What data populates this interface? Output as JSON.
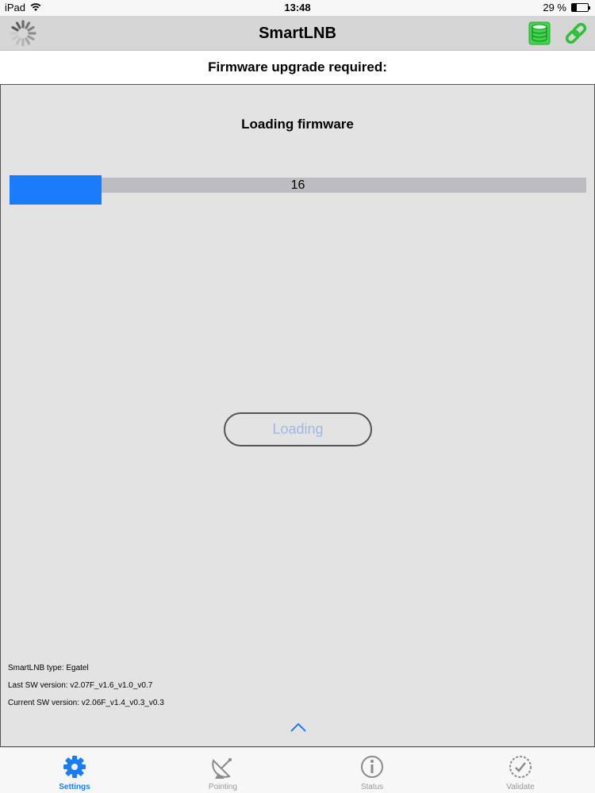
{
  "status_bar": {
    "device": "iPad",
    "time": "13:48",
    "battery": "29 %",
    "battery_level": 0.29
  },
  "nav": {
    "title": "SmartLNB"
  },
  "subheader": "Firmware upgrade required:",
  "panel": {
    "title": "Loading firmware",
    "progress": {
      "value": 16,
      "fraction": 0.16
    },
    "button_label": "Loading"
  },
  "info": {
    "type": "SmartLNB type: Egatel",
    "last_sw": "Last SW version: v2.07F_v1.6_v1.0_v0.7",
    "current_sw": "Current SW version: v2.06F_v1.4_v0.3_v0.3"
  },
  "tabs": [
    {
      "label": "Settings",
      "icon": "gear-icon",
      "active": true
    },
    {
      "label": "Pointing",
      "icon": "satellite-dish-icon",
      "active": false
    },
    {
      "label": "Status",
      "icon": "info-icon",
      "active": false
    },
    {
      "label": "Validate",
      "icon": "validate-icon",
      "active": false
    }
  ],
  "colors": {
    "accent": "#1a7cfa",
    "db_green": "#3fd54a",
    "link_green": "#2fbf3a"
  }
}
